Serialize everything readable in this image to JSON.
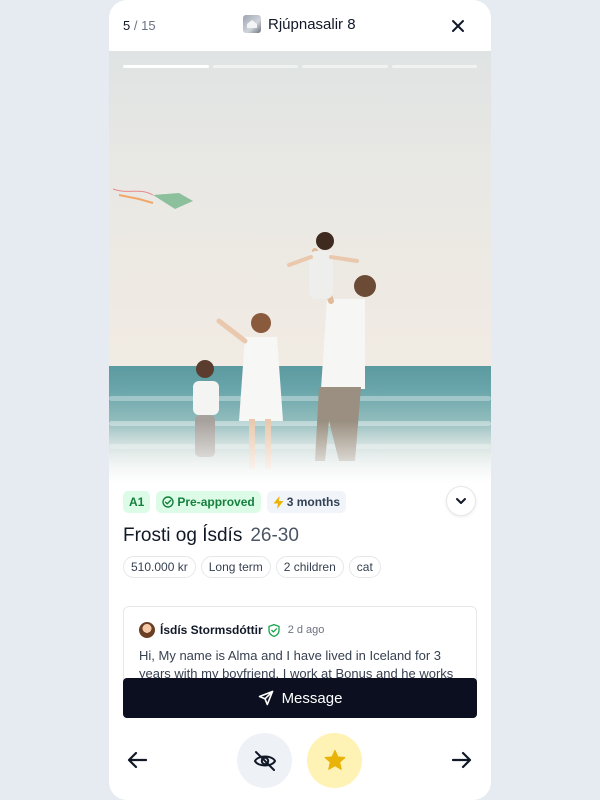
{
  "header": {
    "counter_current": "5",
    "counter_total": "/ 15",
    "title": "Rjúpnasalir 8"
  },
  "gallery": {
    "total_images": 4,
    "active_index": 1
  },
  "tags": {
    "level": "A1",
    "approval": "Pre-approved",
    "duration": "3 months"
  },
  "applicant": {
    "name": "Frosti og Ísdís",
    "age_range": "26-30"
  },
  "attributes": [
    "510.000 kr",
    "Long term",
    "2 children",
    "cat"
  ],
  "message_card": {
    "sender": "Ísdís Stormsdóttir",
    "time": "2 d ago",
    "text": "Hi, My name is Alma and I have lived in Iceland for 3 years with my boyfriend. I work at Bonus and he works"
  },
  "actions": {
    "message_label": "Message"
  },
  "colors": {
    "primary_dark": "#0b0f1f",
    "green_badge_bg": "#dcfce7",
    "green_badge_text": "#15803d",
    "star_bg": "#fef3b4",
    "star": "#eab308",
    "hide_bg": "#eef2f6"
  },
  "icons": {
    "close": "close-icon",
    "expand": "chevron-down-icon",
    "approved": "check-circle-icon",
    "duration": "lightning-icon",
    "verified": "shield-check-icon",
    "send": "send-icon",
    "previous": "arrow-left-icon",
    "hide": "eye-off-icon",
    "favorite": "star-icon",
    "next": "arrow-right-icon"
  }
}
